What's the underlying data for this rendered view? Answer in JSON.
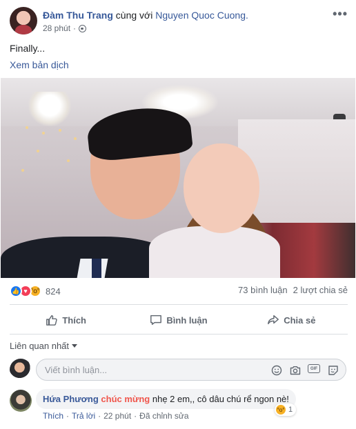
{
  "post": {
    "author": "Đàm Thu Trang",
    "with_text": "cùng với",
    "tagged": "Nguyen Quoc Cuong.",
    "time": "28 phút",
    "privacy_icon": "globe-icon",
    "more_icon": "more-options-icon",
    "more_glyph": "•••",
    "caption": "Finally...",
    "translate": "Xem bản dịch",
    "photo_icon": "wedding-selfie-photo"
  },
  "stats": {
    "reaction_icons": [
      "like-icon",
      "love-icon",
      "wow-icon"
    ],
    "reaction_count": "824",
    "comments": "73 bình luận",
    "shares": "2 lượt chia sẻ"
  },
  "actions": {
    "like": "Thích",
    "comment": "Bình luận",
    "share": "Chia sẻ"
  },
  "comments": {
    "sort_label": "Liên quan nhất",
    "input_placeholder": "Viết bình luận...",
    "items": [
      {
        "author": "Hứa Phương",
        "tag": "chúc mừng",
        "text": "nhẹ 2 em,, cô dâu chú rể ngon nè!",
        "reaction_count": "1",
        "like": "Thích",
        "reply": "Trả lời",
        "sep": "·",
        "time": "22 phút",
        "edited": "Đã chỉnh sửa"
      }
    ]
  },
  "colors": {
    "link": "#365899",
    "muted": "#606770",
    "like": "#1877f2",
    "love": "#f33e58",
    "wow": "#f7b125",
    "tag": "#f0564c"
  }
}
